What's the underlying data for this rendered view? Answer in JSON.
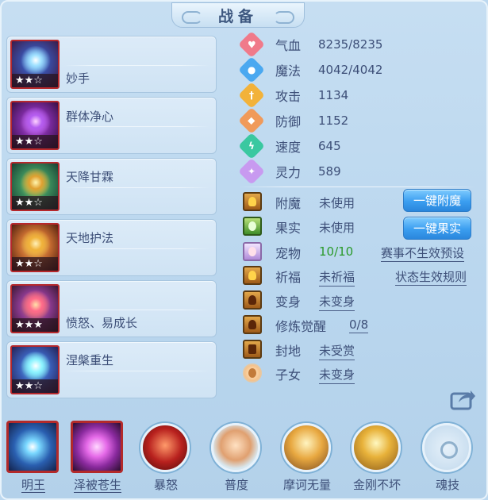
{
  "title": "战备",
  "skills": [
    {
      "name": "妙手",
      "stars": "★★☆"
    },
    {
      "name": "群体净心",
      "stars": "★★☆"
    },
    {
      "name": "天降甘霖",
      "stars": "★★☆"
    },
    {
      "name": "天地护法",
      "stars": "★★☆"
    },
    {
      "name": "愤怒、易成长",
      "stars": "★★★"
    },
    {
      "name": "涅槃重生",
      "stars": "★★☆"
    }
  ],
  "stats": [
    {
      "label": "气血",
      "value": "8235/8235",
      "icon": "heart-icon",
      "color": "#f07a8a"
    },
    {
      "label": "魔法",
      "value": "4042/4042",
      "icon": "mana-icon",
      "color": "#4aa8f0"
    },
    {
      "label": "攻击",
      "value": "1134",
      "icon": "sword-icon",
      "color": "#f2b23a"
    },
    {
      "label": "防御",
      "value": "1152",
      "icon": "shield-icon",
      "color": "#f09a5a"
    },
    {
      "label": "速度",
      "value": "645",
      "icon": "speed-icon",
      "color": "#3ac8a0"
    },
    {
      "label": "灵力",
      "value": "589",
      "icon": "spirit-icon",
      "color": "#c89af0"
    }
  ],
  "attrs": [
    {
      "label": "附魔",
      "value": "未使用"
    },
    {
      "label": "果实",
      "value": "未使用"
    },
    {
      "label": "宠物",
      "value": "10/10"
    },
    {
      "label": "祈福",
      "value": "未祈福"
    },
    {
      "label": "变身",
      "value": "未变身"
    },
    {
      "label": "修炼觉醒",
      "value": "0/8"
    },
    {
      "label": "封地",
      "value": "未受赏"
    },
    {
      "label": "子女",
      "value": "未变身"
    }
  ],
  "buttons": {
    "enchant": "一键附魔",
    "fruit": "一键果实"
  },
  "links": {
    "preset": "赛事不生效预设",
    "rules": "状态生效规则"
  },
  "bottom_skills": [
    {
      "label": "明王"
    },
    {
      "label": "泽被苍生"
    },
    {
      "label": "暴怒"
    },
    {
      "label": "普度"
    },
    {
      "label": "摩诃无量"
    },
    {
      "label": "金刚不坏"
    },
    {
      "label": "魂技"
    }
  ],
  "colors": {
    "accent_button": "#3b9ef0",
    "pet_value": "#2a9a2a",
    "skill_border": "#b6282c"
  }
}
